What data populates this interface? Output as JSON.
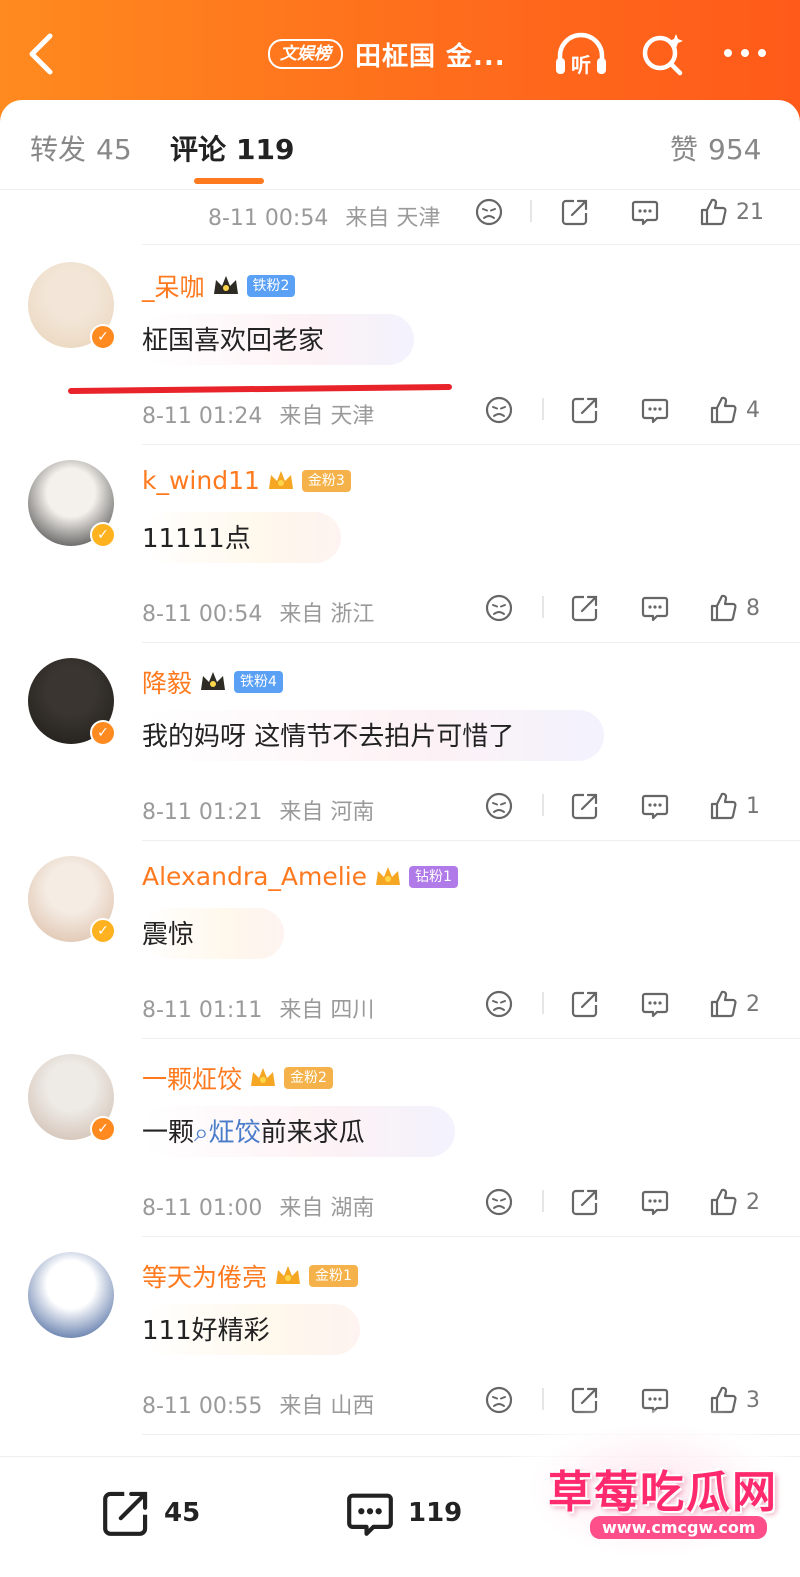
{
  "header": {
    "rank_badge": "文娱榜",
    "title": "田柾国 金...",
    "icons": [
      "back-icon",
      "listen-icon",
      "search-icon",
      "more-icon"
    ],
    "listen_label": "听",
    "accent_color": "#ff6d1c"
  },
  "tabs": {
    "repost_label": "转发",
    "repost_count": "45",
    "comment_label": "评论",
    "comment_count": "119",
    "like_label": "赞",
    "like_count": "954"
  },
  "first_meta": {
    "time": "8-11 00:54",
    "from": "来自",
    "place": "天津",
    "likes": "21"
  },
  "comments": [
    {
      "name": "_呆咖",
      "fan_badge": "铁粉2",
      "fan_color": "#5aa0f5",
      "text": "柾国喜欢回老家",
      "time": "8-11 01:24",
      "from": "来自",
      "place": "天津",
      "likes": "4",
      "vcolor": "#ff8a1f"
    },
    {
      "name": "k_wind11",
      "fan_badge": "金粉3",
      "fan_color": "#f5b24a",
      "text": "11111点",
      "time": "8-11 00:54",
      "from": "来自",
      "place": "浙江",
      "likes": "8",
      "vcolor": "#ffb21f"
    },
    {
      "name": "降毅",
      "fan_badge": "铁粉4",
      "fan_color": "#5aa0f5",
      "text": "我的妈呀 这情节不去拍片可惜了",
      "time": "8-11 01:21",
      "from": "来自",
      "place": "河南",
      "likes": "1",
      "vcolor": "#ff8a1f"
    },
    {
      "name": "Alexandra_Amelie",
      "fan_badge": "钻粉1",
      "fan_color": "#b07ae8",
      "text": "震惊",
      "time": "8-11 01:11",
      "from": "来自",
      "place": "四川",
      "likes": "2",
      "vcolor": "#ffb21f"
    },
    {
      "name": "一颗炡饺",
      "fan_badge": "金粉2",
      "fan_color": "#f5b24a",
      "text_pre": "一颗",
      "text_topic": "炡饺",
      "text_post": "前来求瓜",
      "time": "8-11 01:00",
      "from": "来自",
      "place": "湖南",
      "likes": "2",
      "vcolor": "#ff8a1f"
    },
    {
      "name": "等天为倦亮",
      "fan_badge": "金粉1",
      "fan_color": "#f5b24a",
      "text": "111好精彩",
      "time": "8-11 00:55",
      "from": "来自",
      "place": "山西",
      "likes": "3"
    }
  ],
  "bottom": {
    "repost_count": "45",
    "comment_count": "119"
  },
  "watermark": {
    "text": "草莓吃瓜网",
    "url": "www.cmcgw.com"
  }
}
